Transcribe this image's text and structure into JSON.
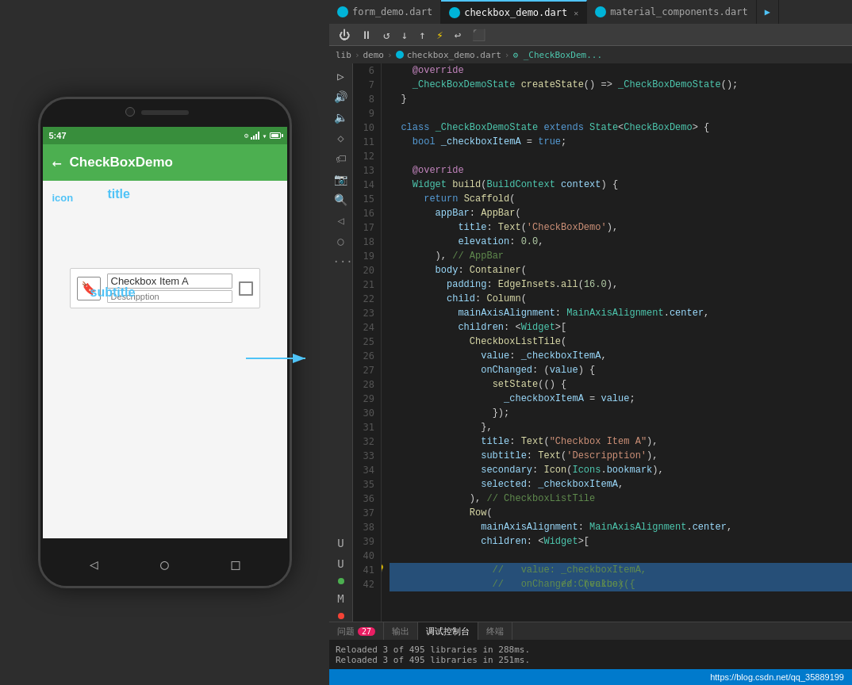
{
  "tabs": [
    {
      "label": "form_demo.dart",
      "active": false,
      "closeable": false
    },
    {
      "label": "checkbox_demo.dart",
      "active": true,
      "closeable": true
    },
    {
      "label": "material_components.dart",
      "active": false,
      "closeable": false
    }
  ],
  "breadcrumb": {
    "parts": [
      "lib",
      "demo",
      "checkbox_demo.dart",
      "_CheckBoxDem..."
    ]
  },
  "toolbar_buttons": [
    "⏻",
    "⏸",
    "↺",
    "↓",
    "↑",
    "⚡",
    "↩",
    "⬜"
  ],
  "phone": {
    "status_time": "5:47",
    "app_title": "CheckBoxDemo",
    "tile_title": "Checkbox Item A",
    "tile_subtitle": "Descripption"
  },
  "annotations": {
    "icon_label": "icon",
    "title_label": "title",
    "subtitle_label": "subtitle"
  },
  "code_lines": [
    {
      "num": 6,
      "content": "    @override",
      "highlight": false
    },
    {
      "num": 7,
      "content": "    _CheckBoxDemoState createState() => _CheckBoxDemoState();",
      "highlight": false
    },
    {
      "num": 8,
      "content": "  }",
      "highlight": false
    },
    {
      "num": 9,
      "content": "",
      "highlight": false
    },
    {
      "num": 10,
      "content": "  class _CheckBoxDemoState extends State<CheckBoxDemo> {",
      "highlight": false
    },
    {
      "num": 11,
      "content": "    bool _checkboxItemA = true;",
      "highlight": false
    },
    {
      "num": 12,
      "content": "",
      "highlight": false
    },
    {
      "num": 13,
      "content": "    @override",
      "highlight": false
    },
    {
      "num": 14,
      "content": "    Widget build(BuildContext context) {",
      "highlight": false
    },
    {
      "num": 15,
      "content": "      return Scaffold(",
      "highlight": false
    },
    {
      "num": 16,
      "content": "        appBar: AppBar(",
      "highlight": false
    },
    {
      "num": 17,
      "content": "            title: Text('CheckBoxDemo'),",
      "highlight": false
    },
    {
      "num": 18,
      "content": "            elevation: 0.0,",
      "highlight": false
    },
    {
      "num": 19,
      "content": "        ), // AppBar",
      "highlight": false
    },
    {
      "num": 20,
      "content": "        body: Container(",
      "highlight": false
    },
    {
      "num": 21,
      "content": "          padding: EdgeInsets.all(16.0),",
      "highlight": false
    },
    {
      "num": 22,
      "content": "          child: Column(",
      "highlight": false
    },
    {
      "num": 23,
      "content": "            mainAxisAlignment: MainAxisAlignment.center,",
      "highlight": false
    },
    {
      "num": 24,
      "content": "            children: <Widget>[",
      "highlight": false
    },
    {
      "num": 25,
      "content": "              CheckboxListTile(",
      "highlight": false
    },
    {
      "num": 26,
      "content": "                value: _checkboxItemA,",
      "highlight": false
    },
    {
      "num": 27,
      "content": "                onChanged: (value) {",
      "highlight": false
    },
    {
      "num": 28,
      "content": "                  setState(() {",
      "highlight": false
    },
    {
      "num": 29,
      "content": "                    _checkboxItemA = value;",
      "highlight": false
    },
    {
      "num": 30,
      "content": "                  });",
      "highlight": false
    },
    {
      "num": 31,
      "content": "                },",
      "highlight": false
    },
    {
      "num": 32,
      "content": "                title: Text(\"Checkbox Item A\"),",
      "highlight": false
    },
    {
      "num": 33,
      "content": "                subtitle: Text('Descripption'),",
      "highlight": false
    },
    {
      "num": 34,
      "content": "                secondary: Icon(Icons.bookmark),",
      "highlight": false
    },
    {
      "num": 35,
      "content": "                selected: _checkboxItemA,",
      "highlight": false
    },
    {
      "num": 36,
      "content": "              ), // CheckboxListTile",
      "highlight": false
    },
    {
      "num": 37,
      "content": "              Row(",
      "highlight": false
    },
    {
      "num": 38,
      "content": "                mainAxisAlignment: MainAxisAlignment.center,",
      "highlight": false
    },
    {
      "num": 39,
      "content": "                children: <Widget>[",
      "highlight": false
    },
    {
      "num": 40,
      "content": "                  // Checkbox(",
      "highlight": false
    },
    {
      "num": 41,
      "content": "                  //   value: _checkboxItemA,",
      "highlight": true
    },
    {
      "num": 42,
      "content": "                  //   onChanged: (value) {",
      "highlight": true
    }
  ],
  "bottom_tabs": [
    {
      "label": "问题",
      "badge": "27",
      "active": false
    },
    {
      "label": "输出",
      "badge": null,
      "active": false
    },
    {
      "label": "调试控制台",
      "badge": null,
      "active": true
    },
    {
      "label": "终端",
      "badge": null,
      "active": false
    }
  ],
  "console_lines": [
    "Reloaded 3 of 495 libraries in 288ms.",
    "Reloaded 3 of 495 libraries in 251ms."
  ],
  "status_bar_url": "https://blog.csdn.net/qq_35889199"
}
